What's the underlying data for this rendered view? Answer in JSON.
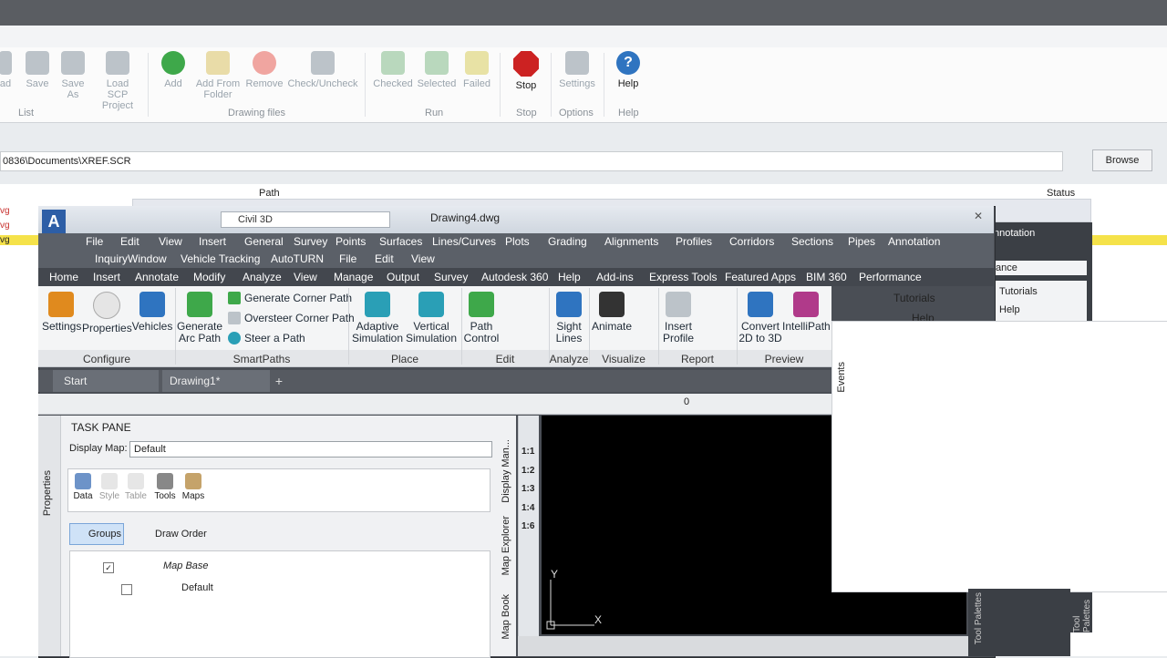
{
  "bg_ribbon": {
    "buttons": [
      {
        "label": "ad"
      },
      {
        "label": "Save"
      },
      {
        "label": "Save As"
      },
      {
        "label": "Load SCP Project"
      },
      {
        "label": "Add"
      },
      {
        "label": "Add From Folder"
      },
      {
        "label": "Remove"
      },
      {
        "label": "Check/Uncheck"
      },
      {
        "label": "Checked"
      },
      {
        "label": "Selected"
      },
      {
        "label": "Failed"
      },
      {
        "label": "Stop"
      },
      {
        "label": "Settings"
      },
      {
        "label": "Help"
      }
    ],
    "groups": [
      "List",
      "Drawing files",
      "Run",
      "Stop",
      "Options",
      "Help"
    ]
  },
  "bg_path": {
    "value": "0836\\Documents\\XREF.SCR",
    "browse": "Browse"
  },
  "bg_table": {
    "col_path": "Path",
    "col_status": "Status",
    "items": [
      "vg",
      "vg",
      "vg"
    ]
  },
  "c3d": {
    "title": "Drawing4.dwg",
    "workspace": "Civil 3D",
    "menu_row1": [
      "File",
      "Edit",
      "View",
      "Insert",
      "General",
      "Survey",
      "Points",
      "Surfaces",
      "Lines/Curves",
      "Plots",
      "Grading",
      "Alignments",
      "Profiles",
      "Corridors",
      "Sections",
      "Pipes",
      "Annotation"
    ],
    "menu_row2": [
      "Inquiry",
      "Window",
      "Vehicle Tracking",
      "AutoTURN",
      "File",
      "Edit",
      "View"
    ],
    "ribbon_tabs": [
      "Home",
      "Insert",
      "Annotate",
      "Modify",
      "Analyze",
      "View",
      "Manage",
      "Output",
      "Survey",
      "Autodesk 360",
      "Help",
      "Add-ins",
      "Express Tools",
      "Featured Apps",
      "BIM 360",
      "Performance"
    ],
    "ribbon": {
      "settings": "Settings",
      "properties": "Properties",
      "vehicles": "Vehicles",
      "gen_arc": "Generate Arc Path",
      "gen_corner": "Generate Corner Path",
      "oversteer": "Oversteer Corner Path",
      "steer": "Steer a Path",
      "adaptive": "Adaptive Simulation",
      "vertical": "Vertical Simulation",
      "path_control": "Path Control",
      "sight": "Sight Lines",
      "animate": "Animate",
      "insert_profile": "Insert Profile",
      "convert": "Convert 2D to 3D",
      "intellipath": "IntelliPath",
      "tutorials": "Tutorials",
      "help": "Help"
    },
    "groups": [
      "Configure",
      "SmartPaths",
      "Place",
      "Edit",
      "Analyze",
      "Visualize",
      "Report",
      "Preview"
    ],
    "doc_tabs": [
      "Start",
      "Drawing1*"
    ],
    "layer_value": "0"
  },
  "taskpane": {
    "title": "TASK PANE",
    "display_map_label": "Display Map:",
    "display_map_value": "Default",
    "tools": [
      "Data",
      "Style",
      "Table",
      "Tools",
      "Maps"
    ],
    "groups_btn": "Groups",
    "draw_order": "Draw Order",
    "tree_root": "Map Base",
    "tree_child": "Default",
    "side_tabs": [
      "Properties",
      "Display Man...",
      "Map Explorer",
      "Map Book"
    ]
  },
  "scales": [
    "1:1",
    "1:2",
    "1:3",
    "1:4",
    "1:6"
  ],
  "right_panel": {
    "annotation": "nnotation",
    "ance": "ance",
    "tutorials": "Tutorials",
    "help": "Help",
    "tool_palettes": "Tool Palettes"
  },
  "events": "Events"
}
